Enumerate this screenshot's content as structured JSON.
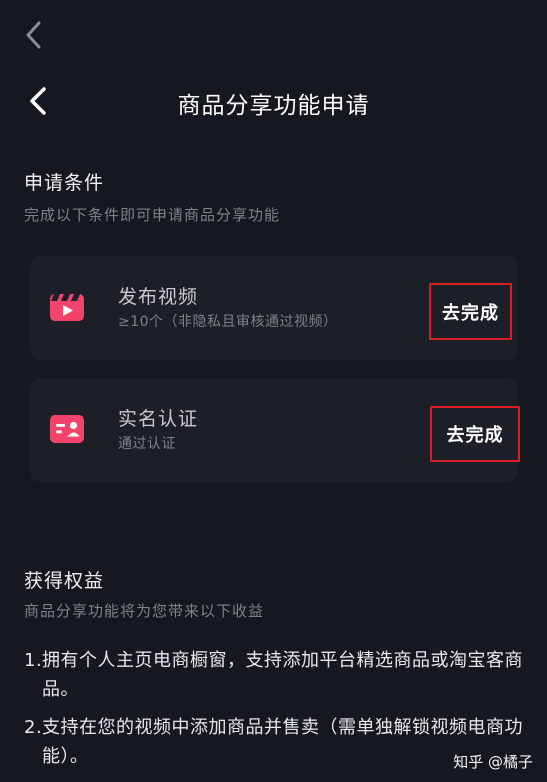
{
  "header": {
    "title": "商品分享功能申请"
  },
  "conditions": {
    "title": "申请条件",
    "subtitle": "完成以下条件即可申请商品分享功能",
    "items": [
      {
        "icon": "video-clapper-icon",
        "title": "发布视频",
        "desc": "≥10个（非隐私且审核通过视频）",
        "action": "去完成"
      },
      {
        "icon": "id-card-icon",
        "title": "实名认证",
        "desc": "通过认证",
        "action": "去完成"
      }
    ]
  },
  "benefits": {
    "title": "获得权益",
    "subtitle": "商品分享功能将为您带来以下收益",
    "items": [
      {
        "num": "1.",
        "text": "拥有个人主页电商橱窗，支持添加平台精选商品或淘宝客商品。"
      },
      {
        "num": "2.",
        "text": "支持在您的视频中添加商品并售卖（需单独解锁视频电商功能）。"
      }
    ]
  },
  "watermark": {
    "text": "知乎 @橘子"
  },
  "colors": {
    "background": "#151820",
    "card": "#1c1f27",
    "icon": "#f2446a",
    "highlight_border": "#d81e1e"
  }
}
